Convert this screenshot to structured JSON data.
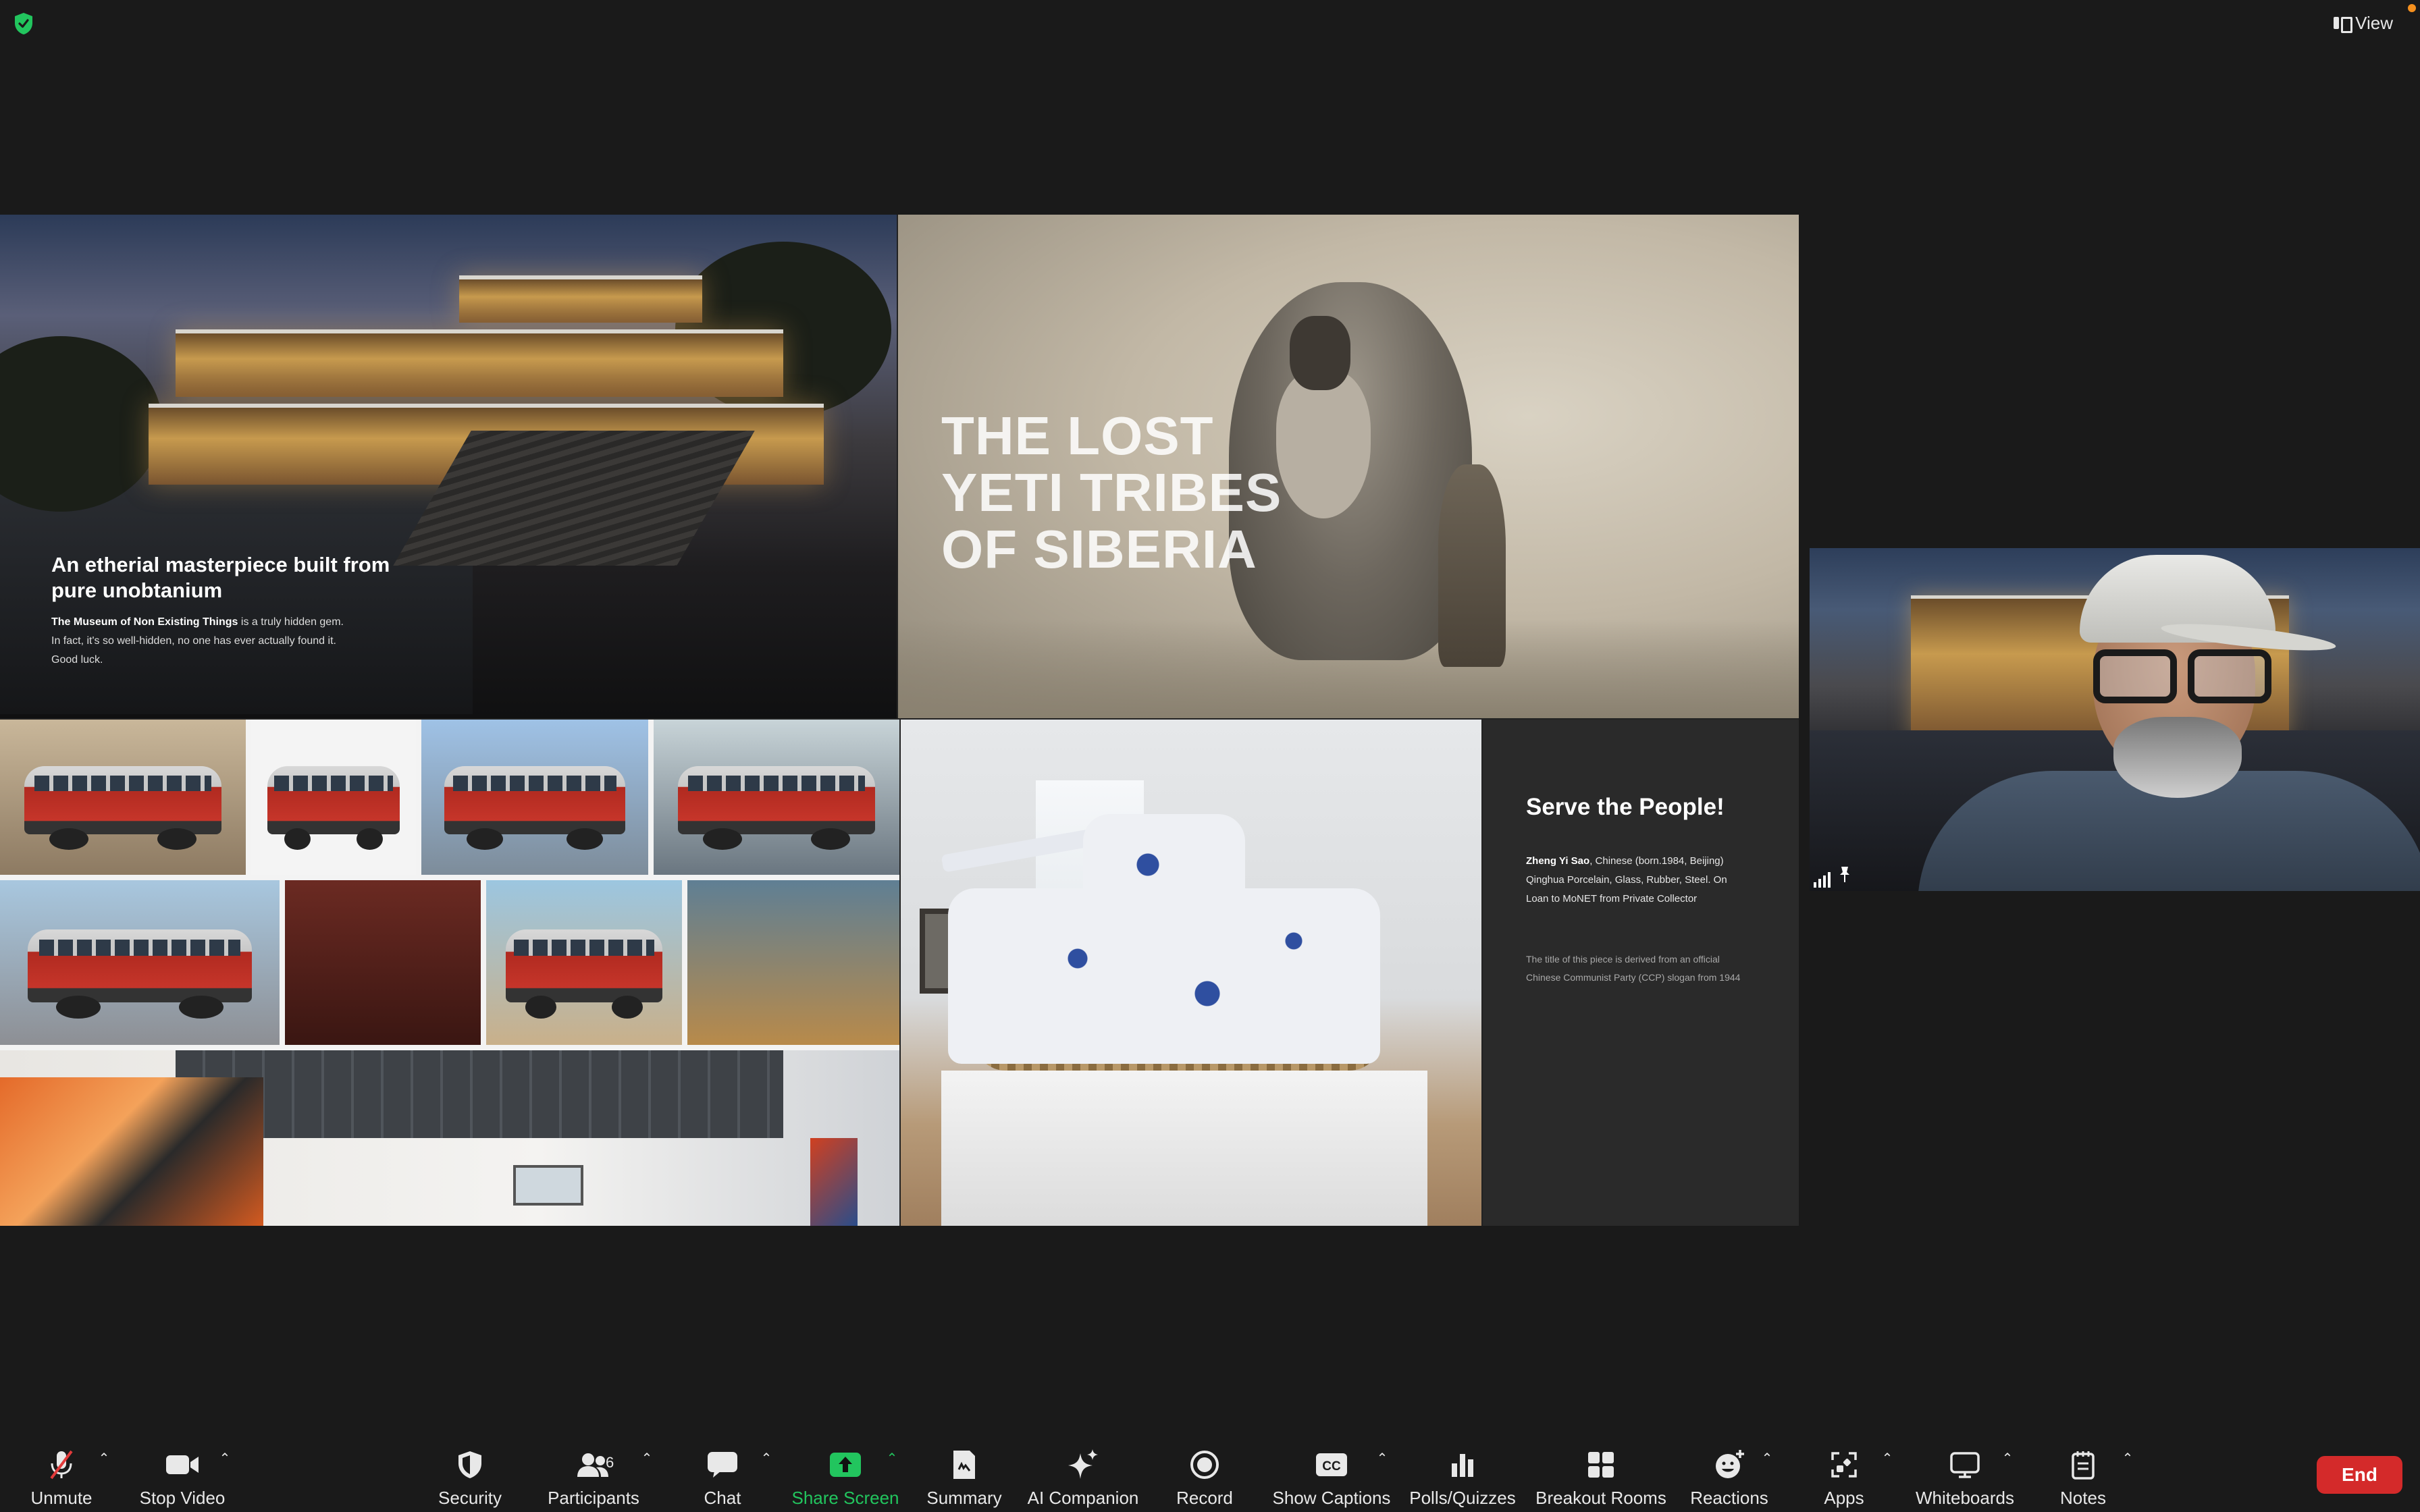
{
  "top": {
    "view_label": "View"
  },
  "slides": {
    "architecture": {
      "title": "An etherial masterpiece built from pure unobtanium",
      "body_bold": "The Museum of Non Existing Things",
      "body_rest": " is a truly hidden gem. In fact, it's so well-hidden, no one has ever actually found it. Good luck."
    },
    "yeti": {
      "title_line1": "THE LOST",
      "title_line2": "YETI TRIBES",
      "title_line3": "OF SIBERIA"
    },
    "artwork": {
      "title": "Serve the People!",
      "artist_bold": "Zheng Yi Sao",
      "details": ", Chinese (born.1984, Beijing) Qinghua Porcelain, Glass, Rubber, Steel. On Loan to MoNET from Private Collector",
      "note": "The title of this piece is derived from an official Chinese Communist Party (CCP) slogan from 1944"
    }
  },
  "toolbar": {
    "unmute": "Unmute",
    "stop_video": "Stop Video",
    "security": "Security",
    "participants": "Participants",
    "participants_count": "6",
    "chat": "Chat",
    "share_screen": "Share Screen",
    "summary": "Summary",
    "ai_companion": "AI Companion",
    "record": "Record",
    "show_captions": "Show Captions",
    "polls": "Polls/Quizzes",
    "breakout_rooms": "Breakout Rooms",
    "reactions": "Reactions",
    "apps": "Apps",
    "whiteboards": "Whiteboards",
    "notes": "Notes",
    "end": "End"
  },
  "colors": {
    "share_green": "#22c55e",
    "end_red": "#d42a2a",
    "shield_green": "#22c55e"
  }
}
